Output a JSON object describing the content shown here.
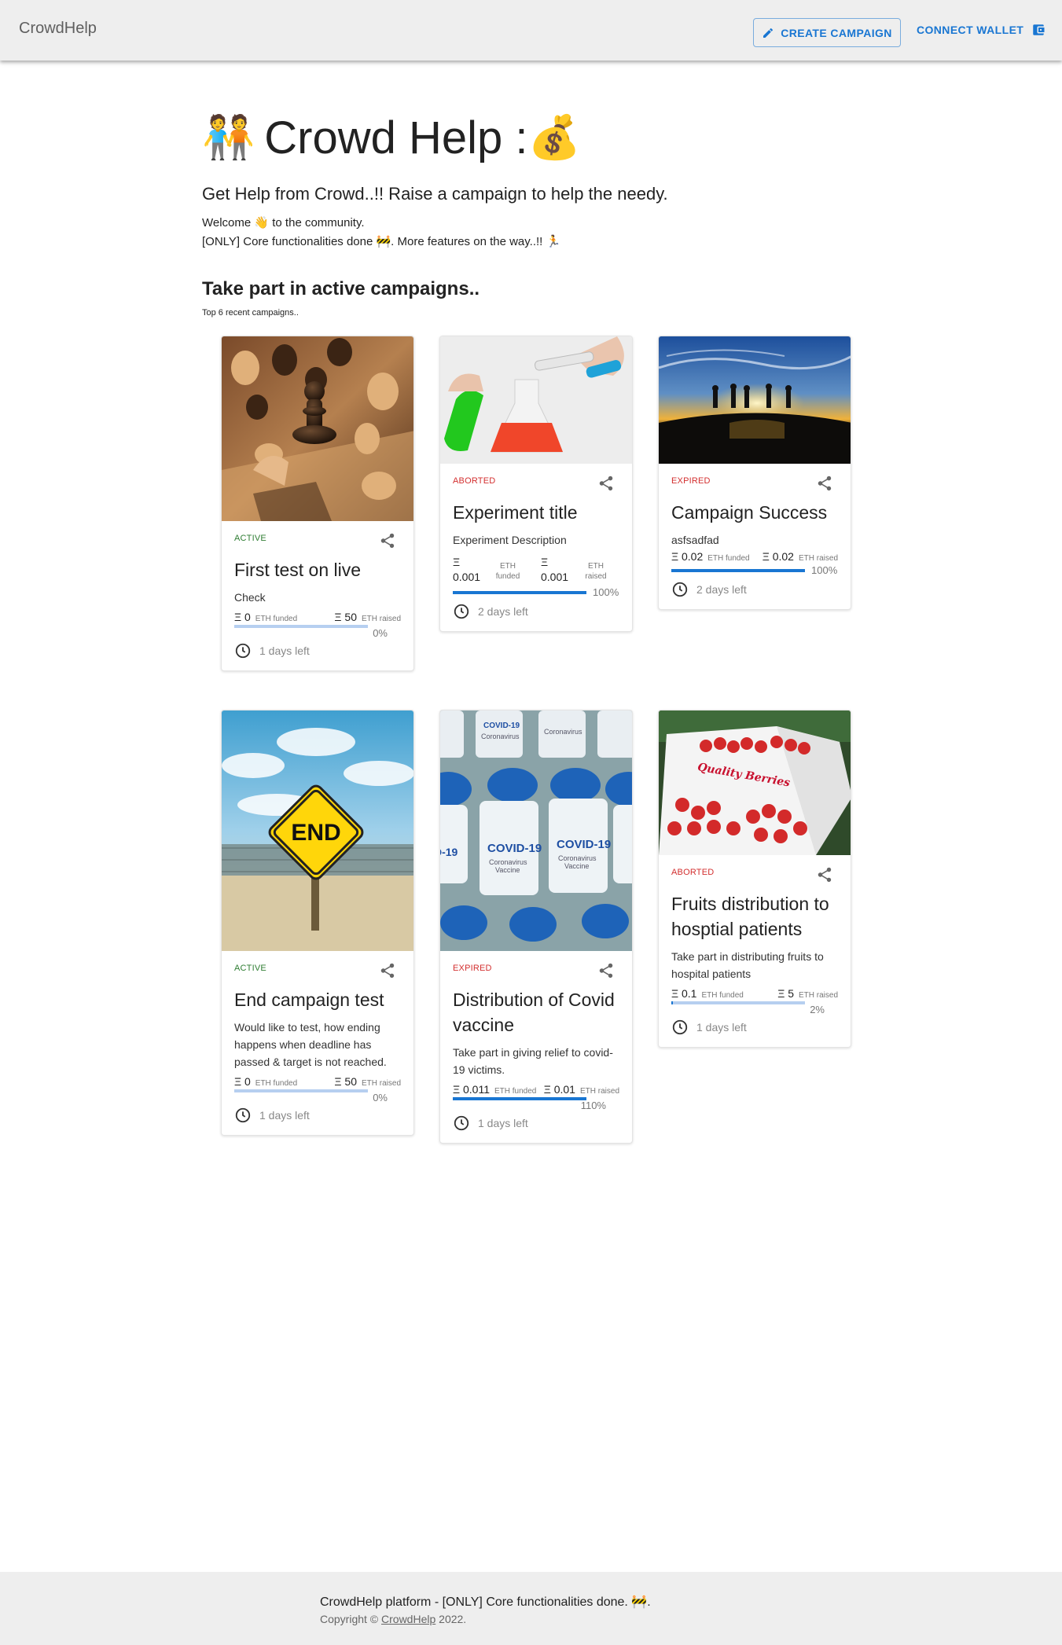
{
  "appbar": {
    "brand": "CrowdHelp",
    "create_label": "CREATE CAMPAIGN",
    "wallet_label": "CONNECT WALLET",
    "accent": "#1976d2"
  },
  "hero": {
    "emoji_left": "🧑‍🤝‍🧑",
    "title": "Crowd Help :",
    "emoji_right": "💰",
    "subtitle": "Get Help from Crowd..!! Raise a campaign to help the needy.",
    "welcome": "Welcome 👋 to the community.",
    "core": "[ONLY] Core functionalities done 🚧. More features on the way..!! 🏃"
  },
  "section": {
    "title": "Take part in active campaigns..",
    "caption": "Top 6 recent campaigns.."
  },
  "campaigns": [
    {
      "status": "ACTIVE",
      "title": "First test on live",
      "description": "Check",
      "funded": "Ξ 0",
      "funded_unit": "ETH funded",
      "raised": "Ξ 50",
      "raised_unit": "ETH raised",
      "percent": "0%",
      "progress": 0,
      "days_left": "1 days left",
      "image": "chess-photo"
    },
    {
      "status": "ABORTED",
      "title": "Experiment title",
      "description": "Experiment Description",
      "funded": "Ξ 0.001",
      "funded_unit": "ETH funded",
      "raised": "Ξ 0.001",
      "raised_unit": "ETH raised",
      "percent": "100%",
      "progress": 1,
      "days_left": "2 days left",
      "image": "lab-flask-photo"
    },
    {
      "status": "EXPIRED",
      "title": "Campaign Success",
      "description": "asfsadfad",
      "funded": "Ξ 0.02",
      "funded_unit": "ETH funded",
      "raised": "Ξ 0.02",
      "raised_unit": "ETH raised",
      "percent": "100%",
      "progress": 1,
      "days_left": "2 days left",
      "image": "sunset-beach-photo"
    },
    {
      "status": "ACTIVE",
      "title": "End campaign test",
      "description": "Would like to test, how ending happens when deadline has passed & target is not reached.",
      "funded": "Ξ 0",
      "funded_unit": "ETH funded",
      "raised": "Ξ 50",
      "raised_unit": "ETH raised",
      "percent": "0%",
      "progress": 0,
      "days_left": "1 days left",
      "image": "end-sign-photo"
    },
    {
      "status": "EXPIRED",
      "title": "Distribution of Covid vaccine",
      "description": "Take part in giving relief to covid-19 victims.",
      "funded": "Ξ 0.011",
      "funded_unit": "ETH funded",
      "raised": "Ξ 0.01",
      "raised_unit": "ETH raised",
      "percent": "110%",
      "progress": 1,
      "days_left": "1 days left",
      "image": "vaccine-vials-photo"
    },
    {
      "status": "ABORTED",
      "title": "Fruits distribution to hosptial patients",
      "description": "Take part in distributing fruits to hospital patients",
      "funded": "Ξ 0.1",
      "funded_unit": "ETH funded",
      "raised": "Ξ 5",
      "raised_unit": "ETH raised",
      "percent": "2%",
      "progress": 0.02,
      "days_left": "1 days left",
      "image": "strawberries-photo",
      "image_text": "Quality Berries"
    }
  ],
  "footer": {
    "main": "CrowdHelp platform - [ONLY] Core functionalities done. 🚧.",
    "copy_prefix": "Copyright © ",
    "copy_link": "CrowdHelp",
    "copy_suffix": " 2022."
  }
}
